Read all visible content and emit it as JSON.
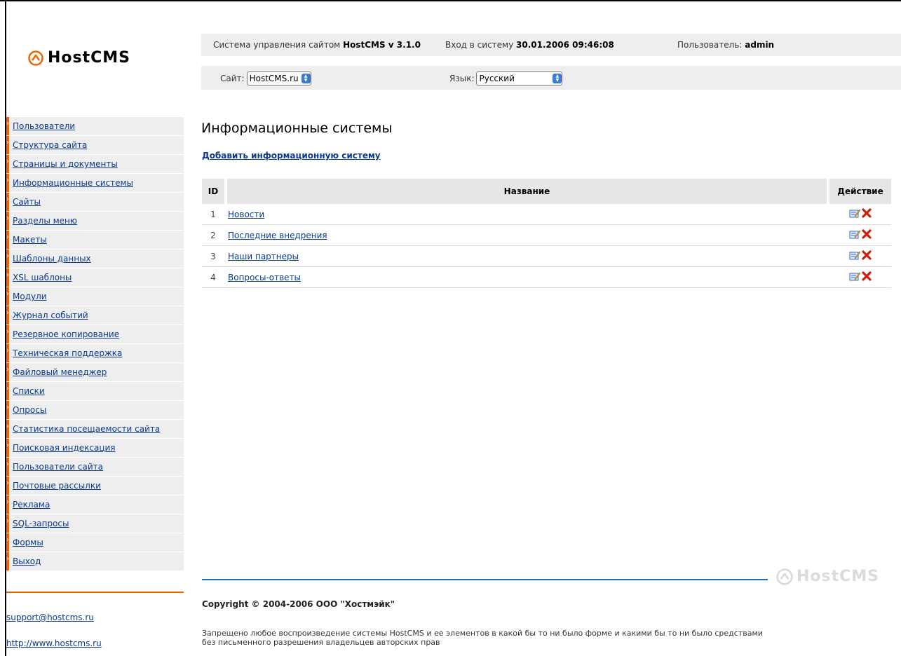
{
  "brand": {
    "name": "HostCMS"
  },
  "header": {
    "system_label": "Система управления сайтом",
    "system_value": "HostCMS v 3.1.0",
    "login_label": "Вход в систему",
    "login_value": "30.01.2006 09:46:08",
    "user_label": "Пользователь:",
    "user_value": "admin"
  },
  "selectors": {
    "site_label": "Сайт:",
    "site_value": "HostCMS.ru",
    "lang_label": "Язык:",
    "lang_value": "Русский"
  },
  "sidebar": {
    "items": [
      "Пользователи",
      "Структура сайта",
      "Страницы и документы",
      "Информационные системы",
      "Сайты",
      "Разделы меню",
      "Макеты",
      "Шаблоны данных",
      "XSL шаблоны",
      "Модули",
      "Журнал событий",
      "Резервное копирование",
      "Техническая поддержка",
      "Файловый менеджер",
      "Списки",
      "Опросы",
      "Статистика посещаемости сайта",
      "Поисковая индексация",
      "Пользователи сайта",
      "Почтовые рассылки",
      "Реклама",
      "SQL-запросы",
      "Формы",
      "Выход"
    ],
    "support_email": "support@hostcms.ru",
    "site_url": "http://www.hostcms.ru"
  },
  "main": {
    "title": "Информационные системы",
    "add_link": "Добавить информационную систему",
    "table": {
      "headers": {
        "id": "ID",
        "name": "Название",
        "action": "Действие"
      },
      "rows": [
        {
          "id": "1",
          "name": "Новости"
        },
        {
          "id": "2",
          "name": "Последние внедрения"
        },
        {
          "id": "3",
          "name": "Наши партнеры"
        },
        {
          "id": "4",
          "name": "Вопросы-ответы"
        }
      ]
    }
  },
  "footer": {
    "copyright": "Copyright © 2004-2006 ООО \"Хостмэйк\"",
    "legal": "Запрещено любое воспроизведение системы HostCMS и ее элементов в какой бы то ни было форме и какими бы то ни было средствами без письменного разрешения владельцев авторских прав"
  },
  "colors": {
    "accent": "#f26400",
    "link": "#0b3a8d",
    "footer_rule": "#1e6fb7",
    "bar_bg": "#eeeeee"
  },
  "icons": {
    "logo": "hostcms-logo-icon",
    "edit": "edit-icon",
    "delete": "delete-icon"
  }
}
